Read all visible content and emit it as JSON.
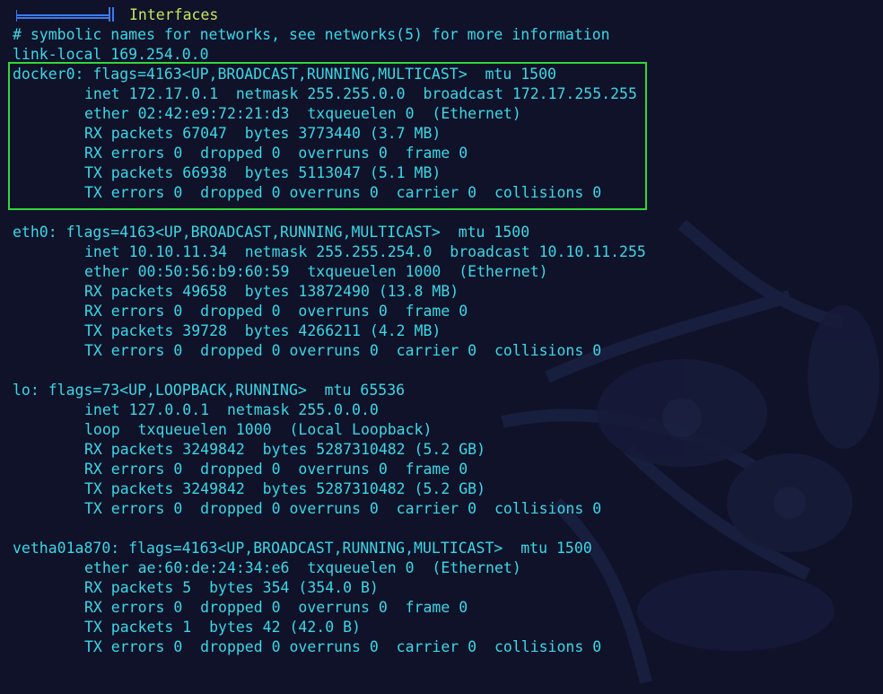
{
  "header": {
    "title": "Interfaces"
  },
  "preamble": [
    "# symbolic names for networks, see networks(5) for more information",
    "link-local 169.254.0.0"
  ],
  "interfaces": [
    {
      "name_line": "docker0: flags=4163<UP,BROADCAST,RUNNING,MULTICAST>  mtu 1500",
      "lines": [
        "inet 172.17.0.1  netmask 255.255.0.0  broadcast 172.17.255.255",
        "ether 02:42:e9:72:21:d3  txqueuelen 0  (Ethernet)",
        "RX packets 67047  bytes 3773440 (3.7 MB)",
        "RX errors 0  dropped 0  overruns 0  frame 0",
        "TX packets 66938  bytes 5113047 (5.1 MB)",
        "TX errors 0  dropped 0 overruns 0  carrier 0  collisions 0"
      ],
      "highlighted": true
    },
    {
      "name_line": "eth0: flags=4163<UP,BROADCAST,RUNNING,MULTICAST>  mtu 1500",
      "lines": [
        "inet 10.10.11.34  netmask 255.255.254.0  broadcast 10.10.11.255",
        "ether 00:50:56:b9:60:59  txqueuelen 1000  (Ethernet)",
        "RX packets 49658  bytes 13872490 (13.8 MB)",
        "RX errors 0  dropped 0  overruns 0  frame 0",
        "TX packets 39728  bytes 4266211 (4.2 MB)",
        "TX errors 0  dropped 0 overruns 0  carrier 0  collisions 0"
      ],
      "highlighted": false
    },
    {
      "name_line": "lo: flags=73<UP,LOOPBACK,RUNNING>  mtu 65536",
      "lines": [
        "inet 127.0.0.1  netmask 255.0.0.0",
        "loop  txqueuelen 1000  (Local Loopback)",
        "RX packets 3249842  bytes 5287310482 (5.2 GB)",
        "RX errors 0  dropped 0  overruns 0  frame 0",
        "TX packets 3249842  bytes 5287310482 (5.2 GB)",
        "TX errors 0  dropped 0 overruns 0  carrier 0  collisions 0"
      ],
      "highlighted": false
    },
    {
      "name_line": "vetha01a870: flags=4163<UP,BROADCAST,RUNNING,MULTICAST>  mtu 1500",
      "lines": [
        "ether ae:60:de:24:34:e6  txqueuelen 0  (Ethernet)",
        "RX packets 5  bytes 354 (354.0 B)",
        "RX errors 0  dropped 0  overruns 0  frame 0",
        "TX packets 1  bytes 42 (42.0 B)",
        "TX errors 0  dropped 0 overruns 0  carrier 0  collisions 0"
      ],
      "highlighted": false
    }
  ],
  "colors": {
    "background": "#0f1229",
    "text": "#3ad8e6",
    "title": "#c6e85a",
    "highlight_border": "#34d63a",
    "header_rule": "#3a7bf0"
  }
}
